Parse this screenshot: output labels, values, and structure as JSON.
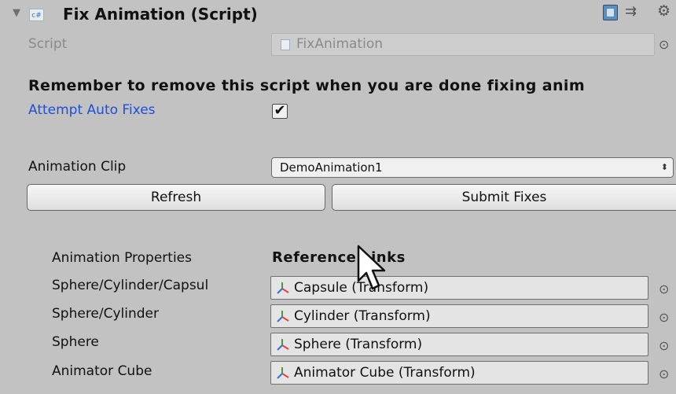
{
  "header": {
    "title": "Fix Animation (Script)",
    "foldout_glyph": "▼",
    "script_icon_text": "c#",
    "help_icon": "help-book-icon",
    "preset_icon": "preset-icon",
    "settings_icon": "gear-icon"
  },
  "script_row": {
    "label": "Script",
    "value": "FixAnimation"
  },
  "warning": "Remember to remove this script when you are done fixing anim",
  "auto_fixes": {
    "label": "Attempt Auto Fixes",
    "checked": true,
    "check_glyph": "✔"
  },
  "animation_clip": {
    "label": "Animation Clip",
    "value": "DemoAnimation1",
    "arrows": "⬍"
  },
  "buttons": {
    "refresh": "Refresh",
    "submit": "Submit Fixes"
  },
  "table": {
    "col_properties": "Animation Properties",
    "col_links": "Reference Links",
    "picker_glyph": "⊙",
    "rows": [
      {
        "property": "Sphere/Cylinder/Capsul",
        "reference": "Capsule (Transform)"
      },
      {
        "property": "Sphere/Cylinder",
        "reference": "Cylinder (Transform)"
      },
      {
        "property": "Sphere",
        "reference": "Sphere (Transform)"
      },
      {
        "property": "Animator Cube",
        "reference": "Animator Cube (Transform)"
      }
    ]
  },
  "colors": {
    "background": "#c2c2c2",
    "label_blue": "#1f4fd8"
  }
}
